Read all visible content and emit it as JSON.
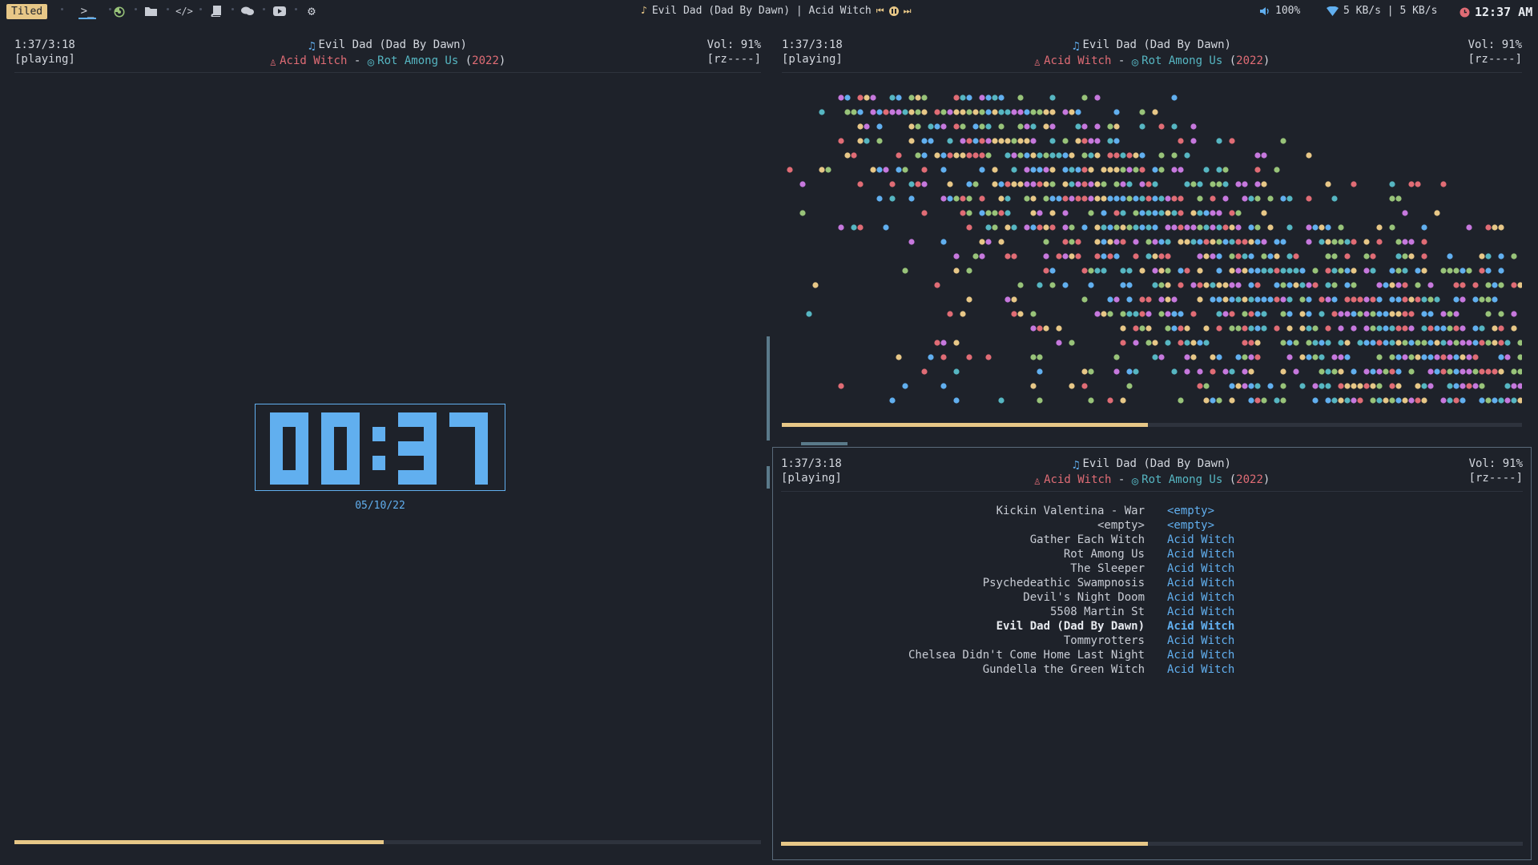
{
  "topbar": {
    "layout_label": "Tiled",
    "workspaces": [
      {
        "icon": "terminal-icon",
        "glyph": ">_",
        "active": true
      },
      {
        "icon": "firefox-icon"
      },
      {
        "icon": "folder-icon"
      },
      {
        "icon": "code-icon",
        "glyph": "</>"
      },
      {
        "icon": "book-icon"
      },
      {
        "icon": "chat-icon"
      },
      {
        "icon": "youtube-icon"
      },
      {
        "icon": "gear-icon"
      }
    ],
    "now_playing": "Evil Dad (Dad By Dawn) | Acid Witch",
    "volume": "100%",
    "network": "5 KB/s | 5 KB/s",
    "clock": "12:37 AM"
  },
  "player": {
    "elapsed": "1:37/3:18",
    "state": "[playing]",
    "volume": "Vol: 91%",
    "flags": "[rz----]",
    "title": "Evil Dad (Dad By Dawn)",
    "artist": "Acid Witch",
    "separator": "-",
    "album": "Rot Among Us",
    "year_open": "(",
    "year": "2022",
    "year_close": ")",
    "progress": 0.495
  },
  "clock": {
    "time": "00:37",
    "date": "05/10/22"
  },
  "playlist": [
    {
      "title": "Kickin Valentina - War",
      "artist": "<empty>"
    },
    {
      "title": "<empty>",
      "artist": "<empty>"
    },
    {
      "title": "Gather Each Witch",
      "artist": "Acid Witch"
    },
    {
      "title": "Rot Among Us",
      "artist": "Acid Witch"
    },
    {
      "title": "The Sleeper",
      "artist": "Acid Witch"
    },
    {
      "title": "Psychedeathic Swampnosis",
      "artist": "Acid Witch"
    },
    {
      "title": "Devil's Night Doom",
      "artist": "Acid Witch"
    },
    {
      "title": "5508 Martin St",
      "artist": "Acid Witch"
    },
    {
      "title": "Evil Dad (Dad By Dawn)",
      "artist": "Acid Witch",
      "current": true
    },
    {
      "title": "Tommyrotters",
      "artist": "Acid Witch"
    },
    {
      "title": "Chelsea Didn't Come Home Last Night",
      "artist": "Acid Witch"
    },
    {
      "title": "Gundella the Green Witch",
      "artist": "Acid Witch"
    }
  ],
  "colors": {
    "background": "#1e222a",
    "accent": "#e7c787",
    "blue": "#61afef",
    "red": "#e06c75",
    "cyan": "#56b6c2",
    "green": "#98c379",
    "purple": "#c678dd"
  }
}
